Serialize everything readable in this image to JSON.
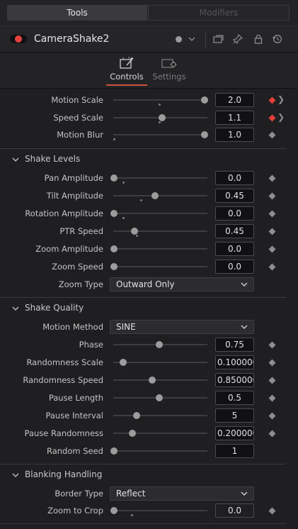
{
  "tabs": {
    "tools": "Tools",
    "modifiers": "Modifiers"
  },
  "node": {
    "name": "CameraShake2"
  },
  "panel_tabs": {
    "controls": "Controls",
    "settings": "Settings"
  },
  "colors": {
    "accent": "#d14f3f",
    "keyframe_active": "#e23f3a",
    "toggle_on": "#e64340"
  },
  "rows": {
    "motion_scale": {
      "label": "Motion Scale",
      "value": "2.0",
      "level": 1.0
    },
    "speed_scale": {
      "label": "Speed Scale",
      "value": "1.1",
      "level": 0.53
    },
    "motion_blur": {
      "label": "Motion Blur",
      "value": "1.0",
      "level": 1.0
    }
  },
  "sections": {
    "shake_levels": {
      "title": "Shake Levels",
      "rows": {
        "pan_amplitude": {
          "label": "Pan Amplitude",
          "value": "0.0",
          "level": 0.0
        },
        "tilt_amplitude": {
          "label": "Tilt Amplitude",
          "value": "0.45",
          "level": 0.45
        },
        "rotation_amplitude": {
          "label": "Rotation Amplitude",
          "value": "0.0",
          "level": 0.0
        },
        "ptr_speed": {
          "label": "PTR Speed",
          "value": "0.45",
          "level": 0.23
        },
        "zoom_amplitude": {
          "label": "Zoom Amplitude",
          "value": "0.0",
          "level": 0.0
        },
        "zoom_speed": {
          "label": "Zoom Speed",
          "value": "0.0",
          "level": 0.0
        }
      },
      "zoom_type": {
        "label": "Zoom Type",
        "value": "Outward Only"
      }
    },
    "shake_quality": {
      "title": "Shake Quality",
      "motion_method": {
        "label": "Motion Method",
        "value": "SINE"
      },
      "rows": {
        "phase": {
          "label": "Phase",
          "value": "0.75",
          "level": 0.5
        },
        "randomness_scale": {
          "label": "Randomness Scale",
          "value": "0.100000",
          "level": 0.1
        },
        "randomness_speed": {
          "label": "Randomness Speed",
          "value": "0.850000",
          "level": 0.42
        },
        "pause_length": {
          "label": "Pause Length",
          "value": "0.5",
          "level": 0.5
        },
        "pause_interval": {
          "label": "Pause Interval",
          "value": "5",
          "level": 0.25
        },
        "pause_randomness": {
          "label": "Pause Randomness",
          "value": "0.200000",
          "level": 0.2
        },
        "random_seed": {
          "label": "Random Seed",
          "value": "1",
          "level": 0.0
        }
      }
    },
    "blanking_handling": {
      "title": "Blanking Handling",
      "border_type": {
        "label": "Border Type",
        "value": "Reflect"
      },
      "rows": {
        "zoom_to_crop": {
          "label": "Zoom to Crop",
          "value": "0.0",
          "level": 0.0
        }
      }
    }
  }
}
